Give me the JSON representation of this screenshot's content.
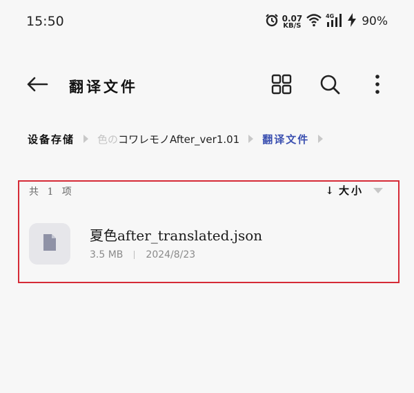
{
  "status_bar": {
    "time": "15:50",
    "net_speed_value": "0.07",
    "net_speed_unit": "KB/S",
    "battery": "90%",
    "icons": [
      "alarm-icon",
      "wifi-icon",
      "signal-4g-icon",
      "charging-icon"
    ]
  },
  "toolbar": {
    "title": "翻译文件",
    "icons": [
      "back-arrow-icon",
      "grid-view-icon",
      "search-icon",
      "more-icon"
    ]
  },
  "breadcrumb": {
    "root": "设备存储",
    "middle_faded": "色の",
    "middle": "コワレモノAfter_ver1.01",
    "current": "翻译文件"
  },
  "list": {
    "count_label": "共 1 项",
    "sort_label": "大小",
    "sort_arrow": "↓"
  },
  "files": [
    {
      "name": "夏色after_translated.json",
      "size": "3.5 MB",
      "date": "2024/8/23",
      "icon": "file-icon"
    }
  ],
  "colors": {
    "background": "#f7f7f7",
    "accent": "#3a4fb0",
    "highlight_border": "#d52a36",
    "file_thumb_bg": "#e6e6ea"
  }
}
